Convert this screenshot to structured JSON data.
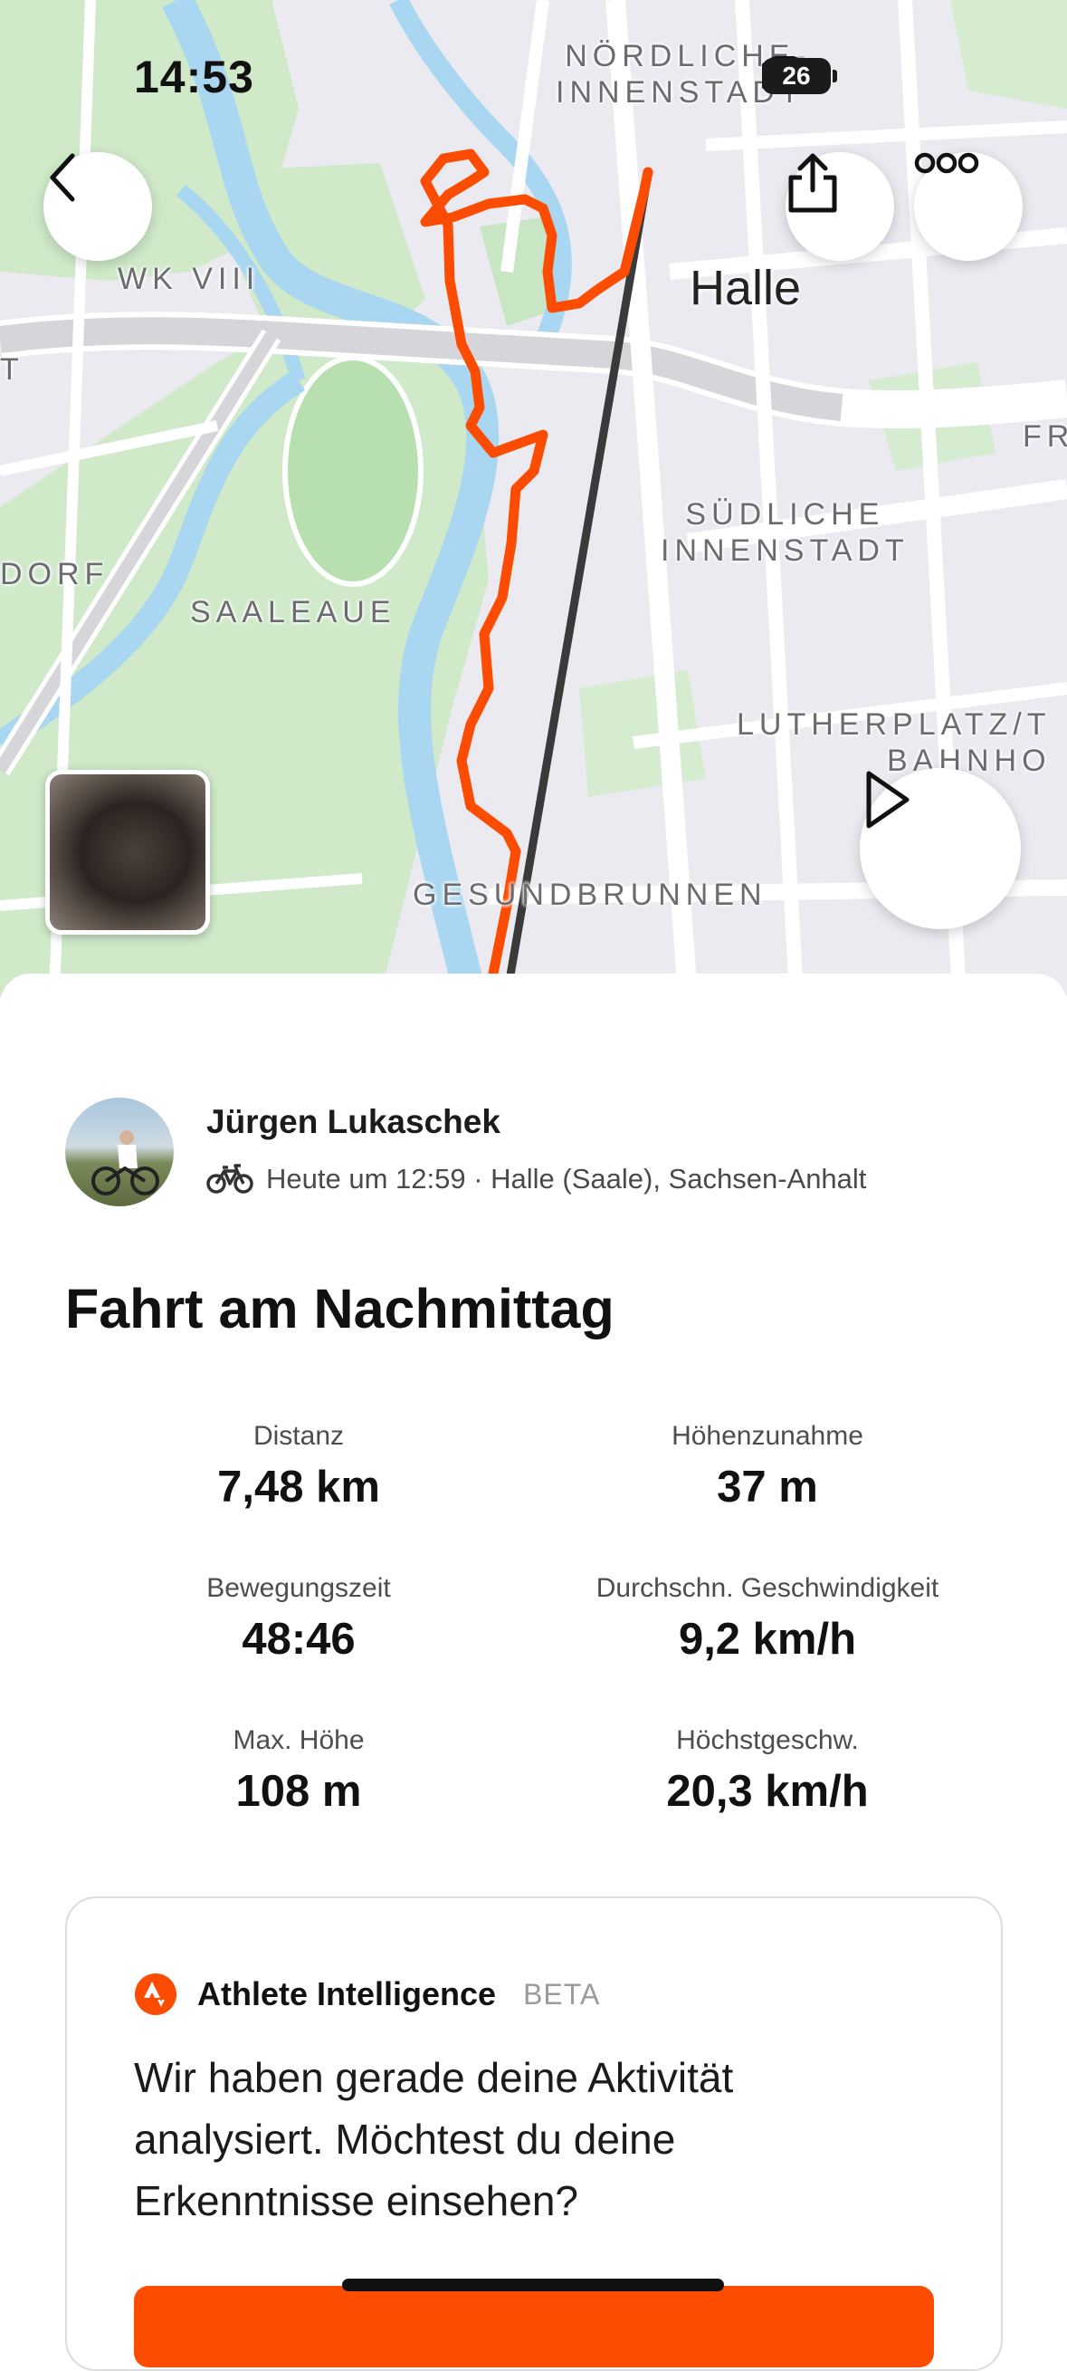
{
  "status_bar": {
    "time": "14:53",
    "battery": "26"
  },
  "map": {
    "labels": {
      "noerdliche": "NÖRDLICHE\nINNENSTADT",
      "wk": "WK VIII",
      "city": "Halle",
      "suedliche": "SÜDLICHE\nINNENSTADT",
      "dorf": "DORF",
      "saaleaue": "SAALEAUE",
      "lutherplatz": "LUTHERPLATZ/T\nBAHNHO",
      "gesundbrunnen": "GESUNDBRUNNEN",
      "fr": "FR",
      "t": "T"
    },
    "route_color": "#fc4c02",
    "buttons": {
      "back": "back-icon",
      "share": "share-icon",
      "more": "more-icon",
      "play": "play-icon"
    }
  },
  "athlete": {
    "name": "Jürgen Lukaschek",
    "meta": "Heute um 12:59 · Halle (Saale), Sachsen-Anhalt",
    "sport_icon": "bike-icon"
  },
  "activity": {
    "title": "Fahrt am Nachmittag",
    "stats": [
      {
        "label": "Distanz",
        "value": "7,48 km"
      },
      {
        "label": "Höhenzunahme",
        "value": "37 m"
      },
      {
        "label": "Bewegungszeit",
        "value": "48:46"
      },
      {
        "label": "Durchschn. Geschwindigkeit",
        "value": "9,2 km/h"
      },
      {
        "label": "Max. Höhe",
        "value": "108 m"
      },
      {
        "label": "Höchstgeschw.",
        "value": "20,3 km/h"
      }
    ]
  },
  "athlete_intelligence": {
    "title": "Athlete Intelligence",
    "badge": "BETA",
    "text": "Wir haben gerade deine Aktivität analysiert. Möchtest du deine Erkenntnisse einsehen?",
    "accent": "#fc4c02"
  }
}
